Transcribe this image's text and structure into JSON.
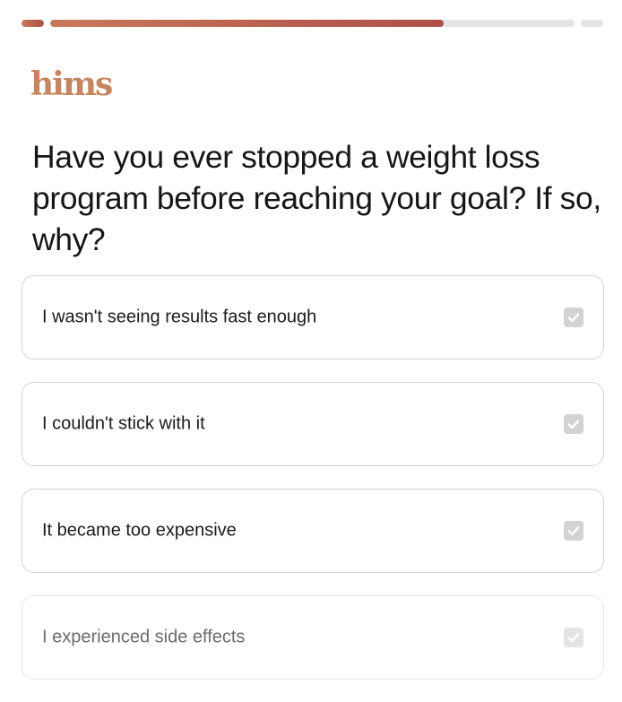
{
  "progress": {
    "segments": [
      {
        "fill": 1.0
      },
      {
        "fill": 0.75
      },
      {
        "fill": 0.0
      }
    ]
  },
  "brand": {
    "logo_text": "hims",
    "color": "#c58560"
  },
  "question": {
    "title": "Have you ever stopped a weight loss program before reaching your goal? If so, why?"
  },
  "options": [
    {
      "label": "I wasn't seeing results fast enough",
      "selected": false
    },
    {
      "label": "I couldn't stick with it",
      "selected": false
    },
    {
      "label": "It became too expensive",
      "selected": false
    },
    {
      "label": "I experienced side effects",
      "selected": false
    }
  ],
  "icons": {
    "option_check": "checkmark-icon"
  },
  "colors": {
    "progress_fill_start": "#c87a5c",
    "progress_fill_end": "#ad5049",
    "progress_track": "#e4e4e4",
    "checkbox": "#d3d3d3"
  }
}
